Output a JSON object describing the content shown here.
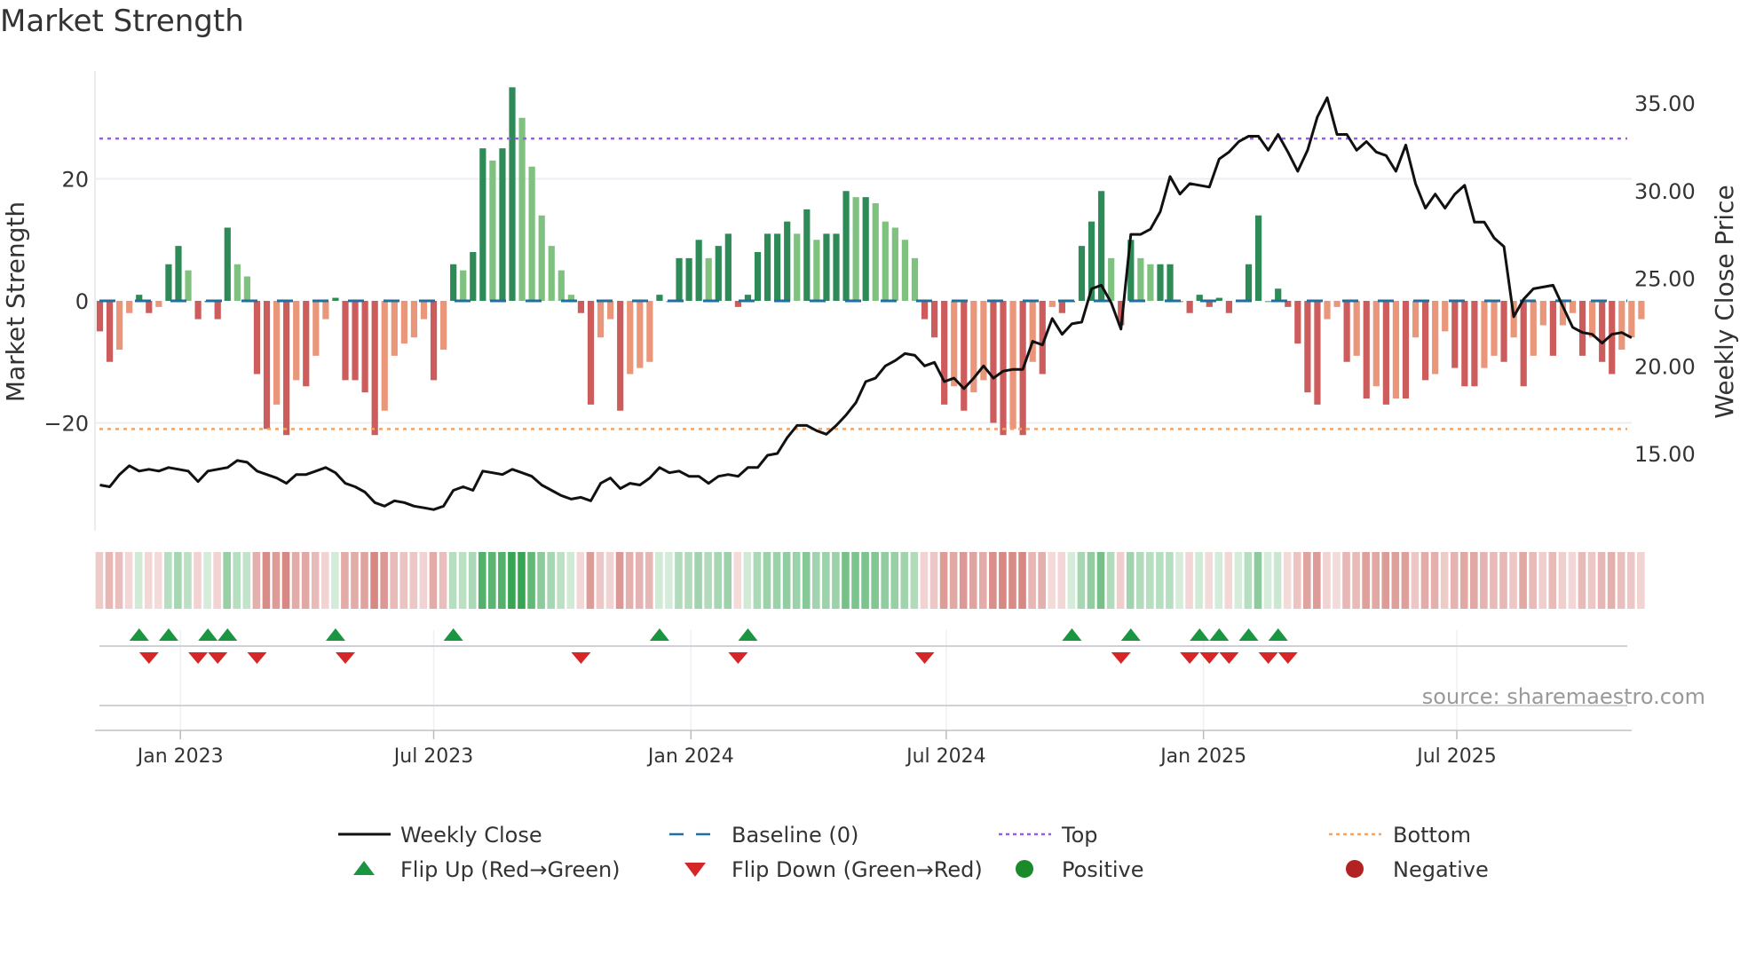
{
  "chart_data": {
    "type": "bar",
    "title": "Market Strength",
    "ylabel": "Market Strength",
    "y2label": "Weekly Close Price",
    "ylim": [
      -37,
      38
    ],
    "y2lim": [
      12,
      36
    ],
    "yticks": [
      {
        "v": 20,
        "label": "20"
      },
      {
        "v": 0,
        "label": "0"
      },
      {
        "v": -20,
        "label": "−20"
      }
    ],
    "y2ticks": [
      {
        "v": 35,
        "label": "35.00"
      },
      {
        "v": 30,
        "label": "30.00"
      },
      {
        "v": 25,
        "label": "25.00"
      },
      {
        "v": 20,
        "label": "20.00"
      },
      {
        "v": 15,
        "label": "15.00"
      }
    ],
    "xticks": [
      {
        "week": 8.2,
        "label": "Jan 2023"
      },
      {
        "week": 34,
        "label": "Jul 2023"
      },
      {
        "week": 60.2,
        "label": "Jan 2024"
      },
      {
        "week": 86.2,
        "label": "Jul 2024"
      },
      {
        "week": 112.4,
        "label": "Jan 2025"
      },
      {
        "week": 138.2,
        "label": "Jul 2025"
      }
    ],
    "top_level": 26.6,
    "bottom_level": -21,
    "strength": [
      -5,
      -10,
      -8,
      -2,
      1,
      -2,
      -1,
      6,
      9,
      5,
      -3,
      0,
      -3,
      12,
      6,
      4,
      -12,
      -21,
      -17,
      -22,
      -13,
      -14,
      -9,
      -3,
      0.5,
      -13,
      -13,
      -15,
      -22,
      -18,
      -9,
      -7,
      -6,
      -3,
      -13,
      -8,
      6,
      5,
      8,
      25,
      23,
      25,
      35,
      30,
      22,
      14,
      9,
      5,
      1,
      -2,
      -17,
      -6,
      -3,
      -18,
      -12,
      -11,
      -10,
      1,
      0,
      7,
      7,
      10,
      7,
      9,
      11,
      -1,
      1,
      8,
      11,
      11,
      13,
      11,
      15,
      10,
      11,
      11,
      18,
      17,
      17,
      16,
      13,
      12,
      10,
      7,
      -3,
      -6,
      -17,
      -14,
      -18,
      -15,
      -13,
      -20,
      -22,
      -21,
      -22,
      -10,
      -12,
      -1,
      -2,
      0,
      9,
      13,
      18,
      7,
      -4,
      10,
      7,
      6,
      6,
      6,
      0,
      -2,
      1,
      -1,
      0.5,
      -2,
      0,
      6,
      14,
      0,
      2,
      -1,
      -7,
      -15,
      -17,
      -3,
      -1,
      -10,
      -9,
      -16,
      -14,
      -17,
      -16,
      -16,
      -6,
      -13,
      -12,
      -5,
      -11,
      -14,
      -14,
      -11,
      -9,
      -10,
      -6,
      -14,
      -9,
      -4,
      -9,
      -4,
      -2,
      -9,
      -6,
      -10,
      -12,
      -8,
      -6,
      -3
    ],
    "weekly_close": [
      13.2,
      13.1,
      13.8,
      14.3,
      14.0,
      14.1,
      14.0,
      14.2,
      14.1,
      14.0,
      13.4,
      14.0,
      14.1,
      14.2,
      14.6,
      14.5,
      14.0,
      13.8,
      13.6,
      13.3,
      13.8,
      13.8,
      14.0,
      14.2,
      13.9,
      13.3,
      13.1,
      12.8,
      12.2,
      12.0,
      12.3,
      12.2,
      12.0,
      11.9,
      11.8,
      12.0,
      12.9,
      13.1,
      12.9,
      14.0,
      13.9,
      13.8,
      14.1,
      13.9,
      13.7,
      13.2,
      12.9,
      12.6,
      12.4,
      12.5,
      12.3,
      13.3,
      13.6,
      13.0,
      13.3,
      13.2,
      13.6,
      14.2,
      13.9,
      14.0,
      13.7,
      13.7,
      13.3,
      13.7,
      13.8,
      13.7,
      14.2,
      14.2,
      14.9,
      15.0,
      15.9,
      16.6,
      16.6,
      16.3,
      16.1,
      16.6,
      17.2,
      17.9,
      19.1,
      19.3,
      20.0,
      20.3,
      20.7,
      20.6,
      20.0,
      20.2,
      19.1,
      19.3,
      18.7,
      19.3,
      20.0,
      19.3,
      19.7,
      19.8,
      19.8,
      21.4,
      21.2,
      22.7,
      21.8,
      22.4,
      22.5,
      24.4,
      24.6,
      23.6,
      22.1,
      27.5,
      27.5,
      27.8,
      28.8,
      30.8,
      29.8,
      30.4,
      30.3,
      30.2,
      31.8,
      32.2,
      32.8,
      33.1,
      33.1,
      32.3,
      33.2,
      32.2,
      31.1,
      32.3,
      34.2,
      35.3,
      33.2,
      33.2,
      32.3,
      32.8,
      32.2,
      32.0,
      31.1,
      32.6,
      30.4,
      29.0,
      29.8,
      29.0,
      29.8,
      30.3,
      28.2,
      28.2,
      27.3,
      26.8,
      22.8,
      23.8,
      24.4,
      24.5,
      24.6,
      23.4,
      22.2,
      21.9,
      21.8,
      21.3,
      21.8,
      21.9,
      21.6
    ],
    "flip_up_weeks": [
      4,
      7,
      11,
      13,
      24,
      36,
      57,
      66,
      99,
      105,
      112,
      114,
      117,
      120
    ],
    "flip_down_weeks": [
      5,
      10,
      12,
      16,
      25,
      49,
      65,
      84,
      104,
      111,
      113,
      115,
      119,
      121
    ],
    "legend": [
      {
        "label": "Weekly Close",
        "kind": "line",
        "color": "#111111"
      },
      {
        "label": "Baseline (0)",
        "kind": "dash",
        "color": "#1f6f9f"
      },
      {
        "label": "Top",
        "kind": "dot",
        "color": "#9b5de5"
      },
      {
        "label": "Bottom",
        "kind": "dot",
        "color": "#f4a261"
      },
      {
        "label": "Flip Up (Red→Green)",
        "kind": "up",
        "color": "#1a9641"
      },
      {
        "label": "Flip Down (Green→Red)",
        "kind": "down",
        "color": "#d62728"
      },
      {
        "label": "Positive",
        "kind": "circle",
        "color": "#1a8a2a"
      },
      {
        "label": "Negative",
        "kind": "circle",
        "color": "#b22222"
      }
    ],
    "source": "source: sharemaestro.com"
  },
  "colors": {
    "pos_dark": "#2e8b57",
    "pos_light": "#7fc17f",
    "neg_dark": "#cd5c5c",
    "neg_light": "#e9967a"
  }
}
